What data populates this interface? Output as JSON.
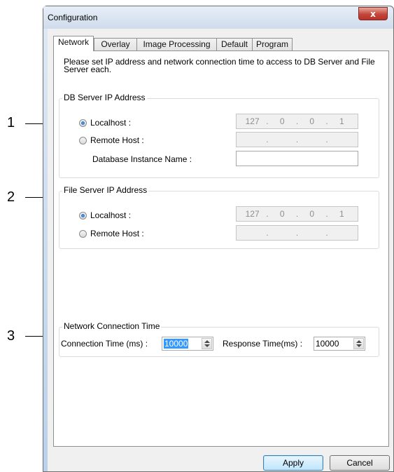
{
  "callouts": [
    "1",
    "2",
    "3"
  ],
  "window": {
    "title": "Configuration",
    "close_label": "x"
  },
  "tabs": [
    {
      "label": "Network",
      "active": true
    },
    {
      "label": "Overlay"
    },
    {
      "label": "Image Processing"
    },
    {
      "label": "Default"
    },
    {
      "label": "Program"
    }
  ],
  "intro_text": "Please set IP address and network connection time to access to DB Server and File Server each.",
  "db_server": {
    "title": "DB Server IP Address",
    "localhost_label": "Localhost :",
    "localhost_selected": true,
    "localhost_ip": [
      "127",
      "0",
      "0",
      "1"
    ],
    "remote_label": "Remote Host :",
    "remote_ip": [
      "",
      "",
      "",
      ""
    ],
    "instance_label": "Database Instance Name :",
    "instance_value": ""
  },
  "file_server": {
    "title": "File Server IP Address",
    "localhost_label": "Localhost :",
    "localhost_selected": true,
    "localhost_ip": [
      "127",
      "0",
      "0",
      "1"
    ],
    "remote_label": "Remote Host :",
    "remote_ip": [
      "",
      "",
      "",
      ""
    ]
  },
  "network_time": {
    "title": "Network Connection Time",
    "connection_label": "Connection Time (ms) :",
    "connection_value": "10000",
    "response_label": "Response Time(ms) :",
    "response_value": "10000"
  },
  "buttons": {
    "apply": "Apply",
    "cancel": "Cancel"
  },
  "colors": {
    "frame": "#b9d1ea",
    "close_button": "#c4463b",
    "selection": "#3399ff",
    "default_button": "#bee6fd"
  },
  "icons": {
    "close": "close-icon",
    "spin_up": "chevron-up-icon",
    "spin_down": "chevron-down-icon"
  }
}
